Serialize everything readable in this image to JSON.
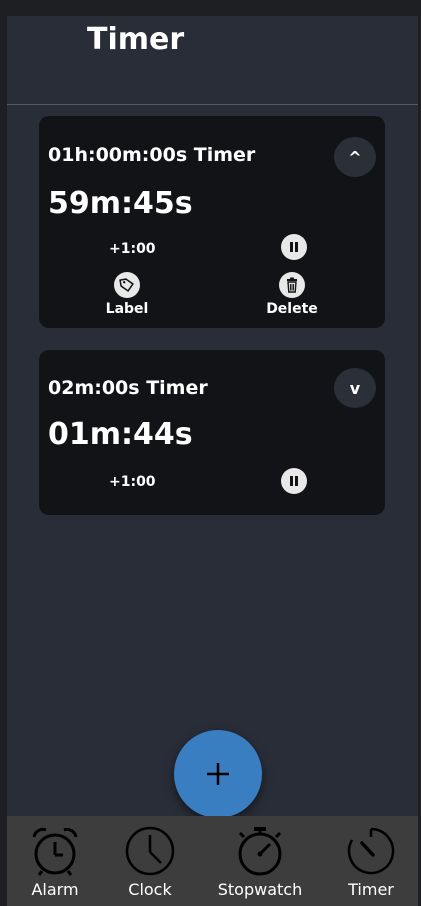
{
  "header": {
    "title": "Timer"
  },
  "timers": [
    {
      "name": "01h:00m:00s Timer",
      "remaining": "59m:45s",
      "add_label": "+1:00",
      "collapse_glyph": "^",
      "expanded": true,
      "actions": {
        "label": "Label",
        "delete": "Delete"
      }
    },
    {
      "name": "02m:00s Timer",
      "remaining": "01m:44s",
      "add_label": "+1:00",
      "collapse_glyph": "v",
      "expanded": false
    }
  ],
  "fab": {
    "icon": "plus-icon"
  },
  "nav": {
    "items": [
      {
        "label": "Alarm",
        "icon": "alarm-clock-icon"
      },
      {
        "label": "Clock",
        "icon": "clock-icon"
      },
      {
        "label": "Stopwatch",
        "icon": "stopwatch-icon"
      },
      {
        "label": "Timer",
        "icon": "timer-icon",
        "active": true
      }
    ]
  },
  "colors": {
    "background": "#292d38",
    "card": "#121317",
    "accent": "#3a7ec2",
    "navbar": "#3d3d3d"
  }
}
